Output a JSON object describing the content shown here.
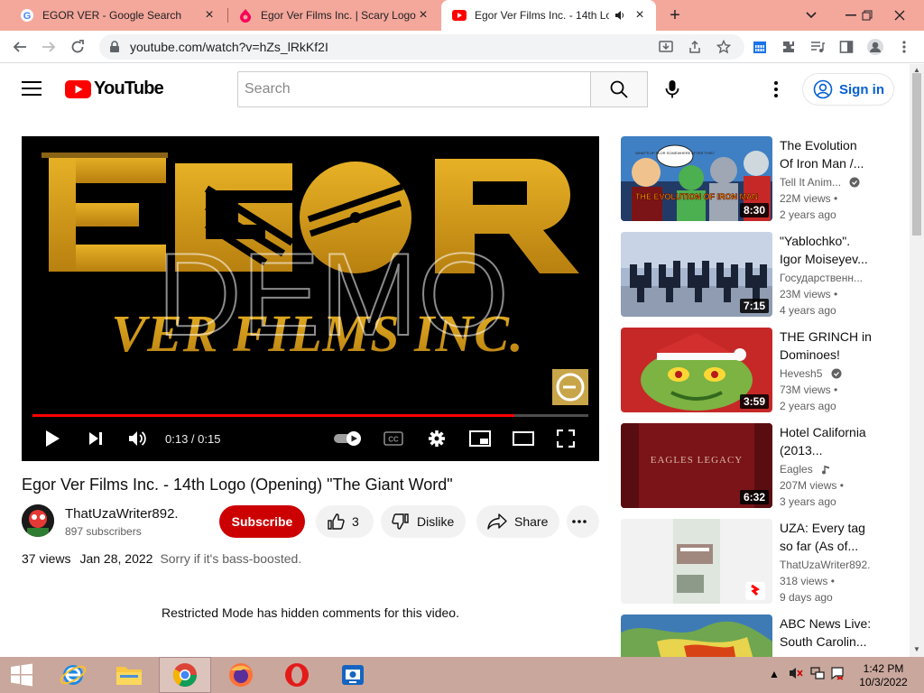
{
  "browser": {
    "tabs": [
      {
        "title": "EGOR VER - Google Search"
      },
      {
        "title": "Egor Ver Films Inc. | Scary Logos"
      },
      {
        "title": "Egor Ver Films Inc. - 14th Lo"
      }
    ],
    "url": "youtube.com/watch?v=hZs_lRkKf2I"
  },
  "header": {
    "logo_text": "YouTube",
    "search_placeholder": "Search",
    "signin_label": "Sign in"
  },
  "player": {
    "time": "0:13 / 0:15",
    "progress": 0.867,
    "logo_text_top": "EGOR",
    "logo_text_bottom": "VER FILMS INC.",
    "watermark": "DEMO"
  },
  "video": {
    "title": "Egor Ver Films Inc. - 14th Logo (Opening) \"The Giant Word\"",
    "channel": "ThatUzaWriter892.",
    "subscribers": "897 subscribers",
    "subscribe_label": "Subscribe",
    "likes": "3",
    "dislike_label": "Dislike",
    "share_label": "Share",
    "views": "37 views",
    "date": "Jan 28, 2022",
    "description": "Sorry if it's bass-boosted.",
    "restricted_note": "Restricted Mode has hidden comments for this video."
  },
  "recommendations": [
    {
      "title": "The Evolution Of Iron Man /...",
      "channel": "Tell It Anim...",
      "views": "22M views",
      "ago": "2 years ago",
      "duration": "8:30",
      "thumb_text": "THE EVOLUTION OF IRON MAN",
      "bubble_text": "WHAT'S UP FLOR SOMEWHERE AFTER THIS?"
    },
    {
      "title": "\"Yablochko\". Igor Moiseyev...",
      "channel": "Государственн...",
      "views": "23M views",
      "ago": "4 years ago",
      "duration": "7:15"
    },
    {
      "title": "THE GRINCH in Dominoes!",
      "channel": "Hevesh5",
      "views": "73M views",
      "ago": "2 years ago",
      "duration": "3:59"
    },
    {
      "title": "Hotel California (2013...",
      "channel": "Eagles",
      "views": "207M views",
      "ago": "3 years ago",
      "duration": "6:32",
      "thumb_text": "EAGLES LEGACY"
    },
    {
      "title": "UZA: Every tag so far (As of...",
      "channel": "ThatUzaWriter892.",
      "views": "318 views",
      "ago": "9 days ago",
      "duration": ""
    },
    {
      "title": "ABC News Live: South Carolin...",
      "channel": "",
      "views": "",
      "ago": "",
      "duration": ""
    }
  ],
  "taskbar": {
    "time": "1:42 PM",
    "date": "10/3/2022"
  },
  "colors": {
    "tabstrip": "#f4a79b",
    "yt_red": "#ff0000",
    "subscribe": "#cc0000",
    "link_blue": "#065fd4",
    "logo_gold": "#d9a21b"
  }
}
